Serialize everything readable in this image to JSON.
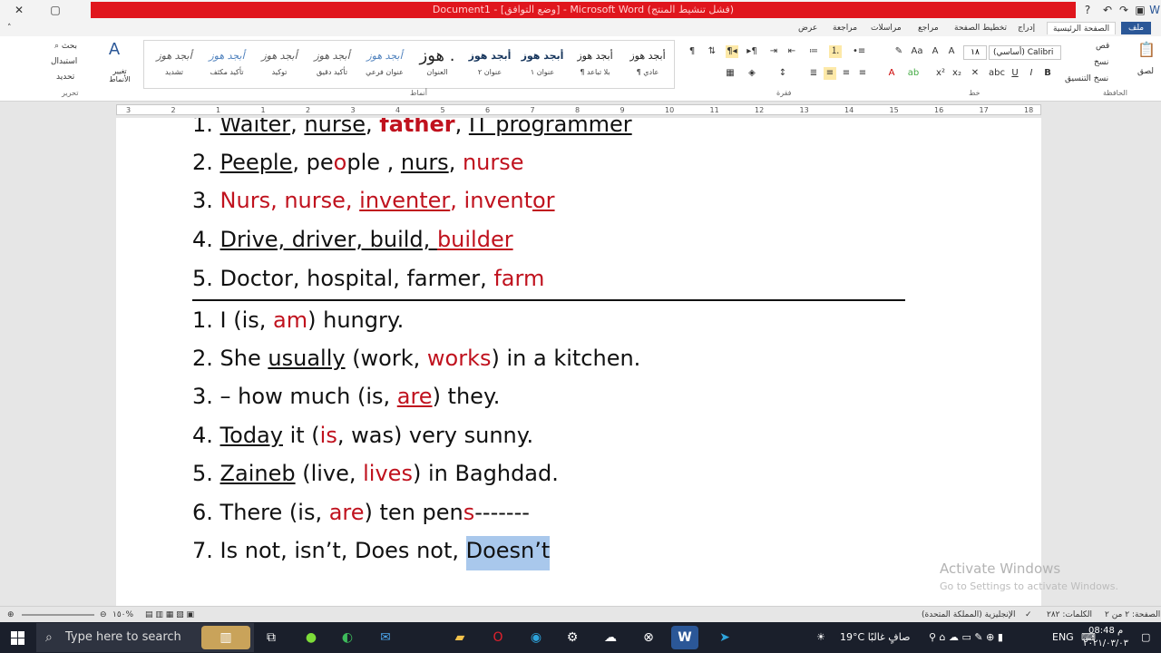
{
  "window": {
    "title": "Document1 - [وضع التوافق] - Microsoft Word (فشل تنشيط المنتج)",
    "controls": [
      "?",
      "—",
      "□",
      "✕"
    ]
  },
  "tabs": [
    {
      "label": "ملف"
    },
    {
      "label": "الصفحة الرئيسية"
    },
    {
      "label": "إدراج"
    },
    {
      "label": "تخطيط الصفحة"
    },
    {
      "label": "مراجع"
    },
    {
      "label": "مراسلات"
    },
    {
      "label": "مراجعة"
    },
    {
      "label": "عرض"
    }
  ],
  "ribbon": {
    "clipboard": {
      "label": "الحافظة",
      "paste": "لصق",
      "cut": "قص",
      "copy": "نسخ",
      "format_painter": "نسخ التنسيق"
    },
    "font": {
      "label": "خط",
      "name": "(أساسي) Calibri",
      "size": "١٨"
    },
    "paragraph": {
      "label": "فقرة"
    },
    "styles": {
      "label": "أنماط",
      "items": [
        {
          "sample": "أبجد هوز",
          "name": "¶ عادي"
        },
        {
          "sample": "أبجد هوز",
          "name": "¶ بلا تباعد"
        },
        {
          "sample": "أبجد هوز",
          "name": "عنوان ١"
        },
        {
          "sample": "أبجد هوز",
          "name": "عنوان ٢"
        },
        {
          "sample": "هوز .",
          "name": "العنوان"
        },
        {
          "sample": "أبجد هوز",
          "name": "عنوان فرعي"
        },
        {
          "sample": "أبجد هوز",
          "name": "تأكيد دقيق"
        },
        {
          "sample": "أبجد هوز",
          "name": "توكيد"
        },
        {
          "sample": "أبجد هوز",
          "name": "تأكيد مكثف"
        },
        {
          "sample": "أبجد هوز",
          "name": "تشديد"
        }
      ],
      "change_styles": "تغيير الأنماط"
    },
    "editing": {
      "label": "تحرير",
      "find": "بحث",
      "replace": "استبدال",
      "select": "تحديد"
    }
  },
  "ruler": {
    "numbers": [
      "18",
      "17",
      "16",
      "15",
      "14",
      "13",
      "12",
      "11",
      "10",
      "9",
      "8",
      "7",
      "6",
      "5",
      "4",
      "3",
      "2",
      "1",
      "1",
      "2",
      "3"
    ]
  },
  "document": {
    "list1": [
      {
        "num": "1.",
        "parts": [
          {
            "t": "Waiter",
            "c": "ul"
          },
          {
            "t": ", ",
            "c": ""
          },
          {
            "t": "nurse",
            "c": "ul"
          },
          {
            "t": ", ",
            "c": ""
          },
          {
            "t": "father",
            "c": "red bold"
          },
          {
            "t": ", ",
            "c": ""
          },
          {
            "t": "IT programmer",
            "c": "ul"
          }
        ]
      },
      {
        "num": "2.",
        "parts": [
          {
            "t": "Peeple",
            "c": "ul"
          },
          {
            "t": ", pe",
            "c": ""
          },
          {
            "t": "o",
            "c": "red"
          },
          {
            "t": "ple , ",
            "c": ""
          },
          {
            "t": "nurs",
            "c": "ul"
          },
          {
            "t": ", ",
            "c": ""
          },
          {
            "t": "nurse",
            "c": "red"
          }
        ]
      },
      {
        "num": "3.",
        "parts": [
          {
            "t": "Nurs, nurse, ",
            "c": "red"
          },
          {
            "t": "inventer",
            "c": "red ul-red"
          },
          {
            "t": ", invent",
            "c": "red"
          },
          {
            "t": "or",
            "c": "red ul-red"
          }
        ]
      },
      {
        "num": "4.",
        "parts": [
          {
            "t": "Drive, driver, build, ",
            "c": "ul"
          },
          {
            "t": "builder",
            "c": "red ul-red"
          }
        ]
      },
      {
        "num": "5.",
        "parts": [
          {
            "t": "Doctor, hospital, farmer, ",
            "c": ""
          },
          {
            "t": "farm",
            "c": "red"
          }
        ]
      }
    ],
    "list2": [
      {
        "num": "1.",
        "parts": [
          {
            "t": "I (is, ",
            "c": ""
          },
          {
            "t": "am",
            "c": "red"
          },
          {
            "t": ") hungry.",
            "c": ""
          }
        ]
      },
      {
        "num": "2.",
        "parts": [
          {
            "t": "She ",
            "c": ""
          },
          {
            "t": "usually",
            "c": "ul"
          },
          {
            "t": " (work, ",
            "c": ""
          },
          {
            "t": "works",
            "c": "red"
          },
          {
            "t": ") in a kitchen.",
            "c": ""
          }
        ]
      },
      {
        "num": "3.",
        "parts": [
          {
            "t": "– how much (is, ",
            "c": ""
          },
          {
            "t": "are",
            "c": "red ul-red"
          },
          {
            "t": ") they.",
            "c": ""
          }
        ]
      },
      {
        "num": "4.",
        "parts": [
          {
            "t": "Today",
            "c": "ul"
          },
          {
            "t": " it (",
            "c": ""
          },
          {
            "t": "is",
            "c": "red"
          },
          {
            "t": ", was) very sunny.",
            "c": ""
          }
        ]
      },
      {
        "num": "5.",
        "parts": [
          {
            "t": "Zaineb",
            "c": "ul"
          },
          {
            "t": " (live, ",
            "c": ""
          },
          {
            "t": "lives",
            "c": "red"
          },
          {
            "t": ") in Baghdad.",
            "c": ""
          }
        ]
      },
      {
        "num": "6.",
        "parts": [
          {
            "t": "There (is, ",
            "c": ""
          },
          {
            "t": "are",
            "c": "red"
          },
          {
            "t": ") ten pen",
            "c": ""
          },
          {
            "t": "s",
            "c": "red"
          },
          {
            "t": "-------",
            "c": ""
          }
        ]
      },
      {
        "num": "7.",
        "parts": [
          {
            "t": "Is not, isn’t, Does not, ",
            "c": ""
          },
          {
            "t": "Doesn’t",
            "c": "sel"
          }
        ]
      }
    ],
    "watermark": {
      "line1": "Activate Windows",
      "line2": "Go to Settings to activate Windows."
    }
  },
  "statusbar": {
    "page": "الصفحة: ٢ من ٢",
    "words": "الكلمات: ٢٨٢",
    "language": "الإنجليزية (المملكة المتحدة)",
    "zoom": "١٥٠%"
  },
  "taskbar": {
    "search_placeholder": "Type here to search",
    "weather": "19°C  صافٍ غالبًا",
    "lang": "ENG",
    "time": "08:48 م",
    "date": "٢٠٢١/٠٣/٠٣"
  }
}
